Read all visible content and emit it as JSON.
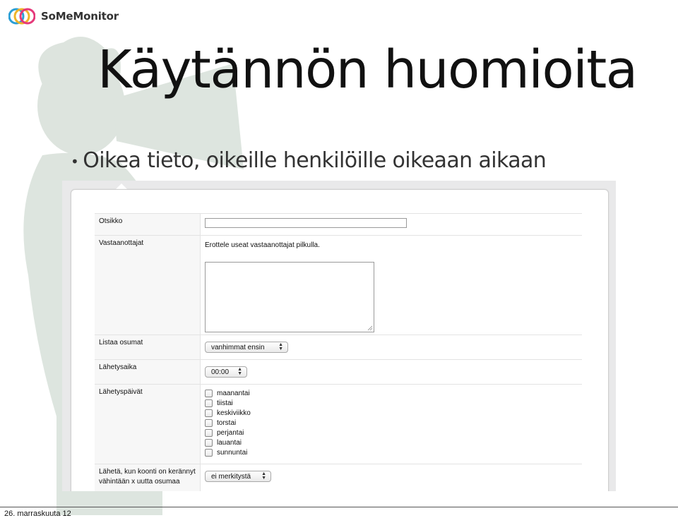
{
  "slide": {
    "title": "Käytännön huomioita",
    "bullet": "Oikea tieto, oikeille henkilöille oikeaan aikaan",
    "footer_date": "26. marraskuuta 12"
  },
  "logo": {
    "text": "SoMeMonitor"
  },
  "form": {
    "title_label": "Otsikko",
    "title_value": "",
    "recipients_label": "Vastaanottajat",
    "recipients_hint": "Erottele useat vastaanottajat pilkulla.",
    "recipients_value": "",
    "list_label": "Listaa osumat",
    "list_value": "vanhimmat ensin",
    "send_time_label": "Lähetysaika",
    "send_time_value": "00:00",
    "send_days_label": "Lähetyspäivät",
    "days": [
      "maanantai",
      "tiistai",
      "keskiviikko",
      "torstai",
      "perjantai",
      "lauantai",
      "sunnuntai"
    ],
    "threshold_label": "Lähetä, kun koonti on kerännyt vähintään x uutta osumaa",
    "threshold_value": "ei merkitystä"
  },
  "colors": {
    "title": "#111111",
    "bullet": "#333333",
    "panel_bg": "#e9e9ea"
  }
}
